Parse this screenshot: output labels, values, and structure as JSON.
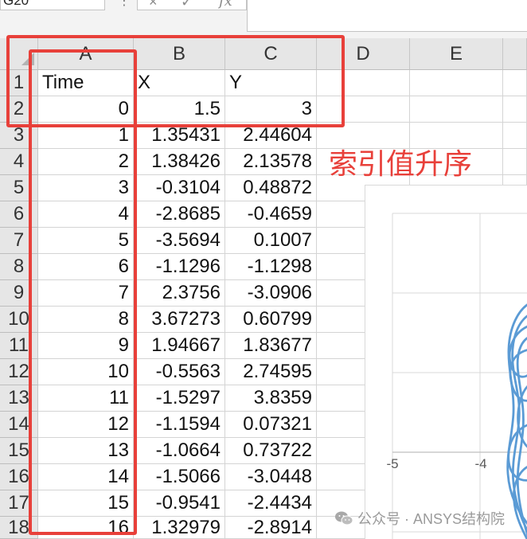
{
  "name_box": {
    "value": "G20"
  },
  "formula_bar": {
    "more_glyph": "⋮",
    "cancel_glyph": "×",
    "enter_glyph": "✓",
    "fx_label": "fx",
    "icons": [
      "more-options-icon",
      "cancel-icon",
      "enter-icon",
      "insert-function-icon"
    ]
  },
  "columns": [
    "A",
    "B",
    "C",
    "D",
    "E"
  ],
  "rows": [
    {
      "num": "1",
      "cells": [
        "Time",
        "X",
        "Y"
      ]
    },
    {
      "num": "2",
      "cells": [
        "0",
        "1.5",
        "3"
      ]
    },
    {
      "num": "3",
      "cells": [
        "1",
        "1.35431",
        "2.44604"
      ]
    },
    {
      "num": "4",
      "cells": [
        "2",
        "1.38426",
        "2.13578"
      ]
    },
    {
      "num": "5",
      "cells": [
        "3",
        "-0.3104",
        "0.48872"
      ]
    },
    {
      "num": "6",
      "cells": [
        "4",
        "-2.8685",
        "-0.4659"
      ]
    },
    {
      "num": "7",
      "cells": [
        "5",
        "-3.5694",
        "0.1007"
      ]
    },
    {
      "num": "8",
      "cells": [
        "6",
        "-1.1296",
        "-1.1298"
      ]
    },
    {
      "num": "9",
      "cells": [
        "7",
        "2.3756",
        "-3.0906"
      ]
    },
    {
      "num": "10",
      "cells": [
        "8",
        "3.67273",
        "0.60799"
      ]
    },
    {
      "num": "11",
      "cells": [
        "9",
        "1.94667",
        "1.83677"
      ]
    },
    {
      "num": "12",
      "cells": [
        "10",
        "-0.5563",
        "2.74595"
      ]
    },
    {
      "num": "13",
      "cells": [
        "11",
        "-1.5297",
        "3.8359"
      ]
    },
    {
      "num": "14",
      "cells": [
        "12",
        "-1.1594",
        "0.07321"
      ]
    },
    {
      "num": "15",
      "cells": [
        "13",
        "-1.0664",
        "0.73722"
      ]
    },
    {
      "num": "16",
      "cells": [
        "14",
        "-1.5066",
        "-3.0448"
      ]
    },
    {
      "num": "17",
      "cells": [
        "15",
        "-0.9541",
        "-2.4434"
      ]
    },
    {
      "num": "18",
      "cells": [
        "16",
        "1.32979",
        "-2.8914"
      ]
    }
  ],
  "annotation": {
    "text": "索引值升序"
  },
  "chart": {
    "x_tick_labels": [
      "-5",
      "-4"
    ]
  },
  "watermark": {
    "text": "公众号 · ANSYS结构院",
    "icon": "wechat-icon"
  },
  "colors": {
    "annotation": "#e8403a",
    "series": "#5b9bd5"
  }
}
